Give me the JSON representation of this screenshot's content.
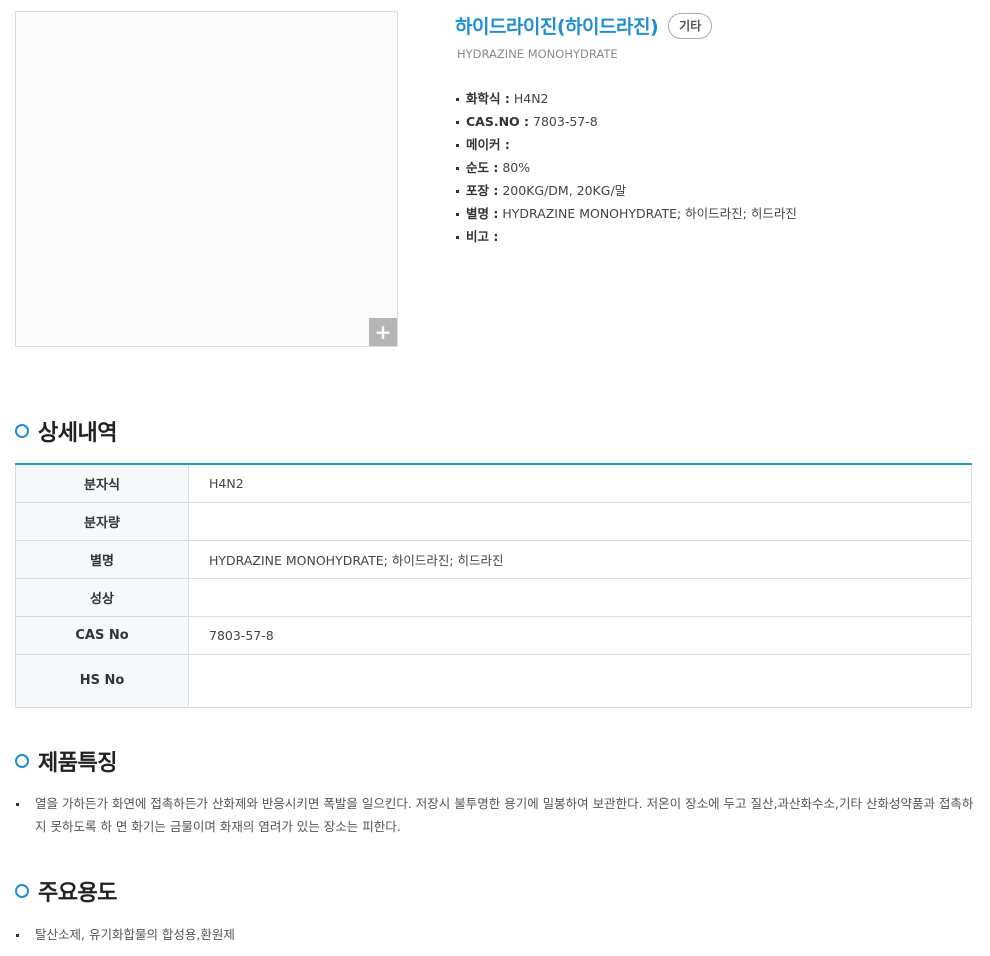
{
  "product": {
    "title": "하이드라이진(하이드라진)",
    "category_badge": "기타",
    "english_name": "HYDRAZINE MONOHYDRATE",
    "zoom_label": "+",
    "specs": [
      {
        "label": "화학식 :",
        "value": "H4N2"
      },
      {
        "label": "CAS.NO :",
        "value": "7803-57-8"
      },
      {
        "label": "메이커 :",
        "value": ""
      },
      {
        "label": "순도 :",
        "value": "80%"
      },
      {
        "label": "포장 :",
        "value": "200KG/DM, 20KG/말"
      },
      {
        "label": "별명 :",
        "value": "HYDRAZINE MONOHYDRATE; 하이드라진; 히드라진"
      },
      {
        "label": "비고 :",
        "value": ""
      }
    ]
  },
  "sections": {
    "details_heading": "상세내역",
    "features_heading": "제품특징",
    "uses_heading": "주요용도"
  },
  "details_table": [
    {
      "label": "분자식",
      "value": "H4N2"
    },
    {
      "label": "분자량",
      "value": ""
    },
    {
      "label": "별명",
      "value": "HYDRAZINE MONOHYDRATE; 하이드라진; 히드라진"
    },
    {
      "label": "성상",
      "value": ""
    },
    {
      "label": "CAS No",
      "value": "7803-57-8"
    },
    {
      "label": "HS No",
      "value": ""
    }
  ],
  "features": {
    "text": "열을 가하든가 화연에 접촉하든가 산화제와 반응시키면 폭발을 일으킨다. 저장시 불투명한 용기에 밀봉하여 보관한다. 저온이 장소에 두고 질산,과산화수소,기타 산화성약품과 접촉하지 못하도록 하 면 화기는 금물이며 화재의 염려가 있는 장소는 피한다."
  },
  "uses": {
    "text": "탈산소제, 유기화합물의 합성용,환원제"
  },
  "colors": {
    "accent": "#1e8fd0",
    "table_border_top": "#1e9fcf"
  }
}
